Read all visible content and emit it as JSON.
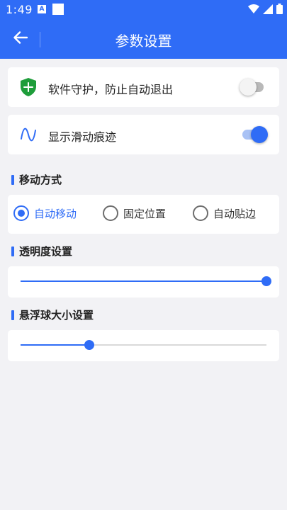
{
  "status_bar": {
    "time": "1:49",
    "notification_letter": "A",
    "icons": [
      "wifi-icon",
      "signal-icon",
      "battery-icon"
    ]
  },
  "app_bar": {
    "title": "参数设置",
    "back_icon": "back-arrow-icon"
  },
  "settings": {
    "guard": {
      "label": "软件守护，防止自动退出",
      "icon": "shield-plus-icon",
      "enabled": false
    },
    "trail": {
      "label": "显示滑动痕迹",
      "icon": "wave-icon",
      "enabled": true
    }
  },
  "move_mode": {
    "title": "移动方式",
    "options": [
      {
        "label": "自动移动",
        "checked": true
      },
      {
        "label": "固定位置",
        "checked": false
      },
      {
        "label": "自动贴边",
        "checked": false
      }
    ]
  },
  "transparency": {
    "title": "透明度设置",
    "value": 1.0
  },
  "ball_size": {
    "title": "悬浮球大小设置",
    "value": 0.28
  },
  "colors": {
    "accent": "#2f6cf6",
    "shield": "#1e9d3a",
    "background": "#f2f2f5"
  }
}
